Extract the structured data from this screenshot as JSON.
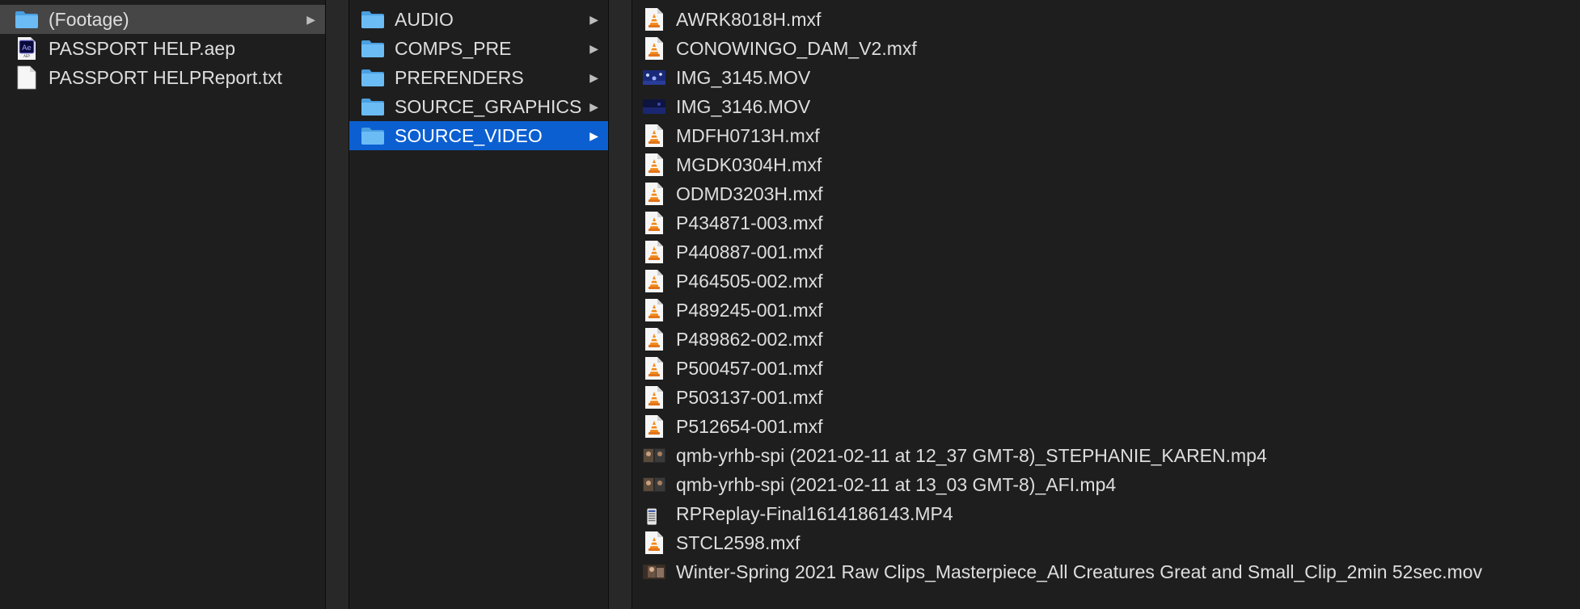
{
  "columns": [
    {
      "items": [
        {
          "label": "(Footage)",
          "icon": "folder-icon",
          "kind": "folder",
          "selected": "inactive",
          "has_children": true
        },
        {
          "label": "PASSPORT HELP.aep",
          "icon": "after-effects-file-icon",
          "kind": "aep",
          "selected": "",
          "has_children": false
        },
        {
          "label": "PASSPORT HELPReport.txt",
          "icon": "text-file-icon",
          "kind": "txt",
          "selected": "",
          "has_children": false
        }
      ]
    },
    {
      "items": [
        {
          "label": "AUDIO",
          "icon": "folder-icon",
          "kind": "folder",
          "selected": "",
          "has_children": true
        },
        {
          "label": "COMPS_PRE",
          "icon": "folder-icon",
          "kind": "folder",
          "selected": "",
          "has_children": true
        },
        {
          "label": "PRERENDERS",
          "icon": "folder-icon",
          "kind": "folder",
          "selected": "",
          "has_children": true
        },
        {
          "label": "SOURCE_GRAPHICS",
          "icon": "folder-icon",
          "kind": "folder",
          "selected": "",
          "has_children": true
        },
        {
          "label": "SOURCE_VIDEO",
          "icon": "folder-icon",
          "kind": "folder",
          "selected": "active",
          "has_children": true
        }
      ]
    },
    {
      "items": [
        {
          "label": "AWRK8018H.mxf",
          "icon": "vlc-file-icon",
          "kind": "mxf",
          "selected": "",
          "has_children": false
        },
        {
          "label": "CONOWINGO_DAM_V2.mxf",
          "icon": "vlc-file-icon",
          "kind": "mxf",
          "selected": "",
          "has_children": false
        },
        {
          "label": "IMG_3145.MOV",
          "icon": "video-thumbnail-icon",
          "kind": "mov-blue",
          "selected": "",
          "has_children": false
        },
        {
          "label": "IMG_3146.MOV",
          "icon": "video-thumbnail-icon",
          "kind": "mov-dark",
          "selected": "",
          "has_children": false
        },
        {
          "label": "MDFH0713H.mxf",
          "icon": "vlc-file-icon",
          "kind": "mxf",
          "selected": "",
          "has_children": false
        },
        {
          "label": "MGDK0304H.mxf",
          "icon": "vlc-file-icon",
          "kind": "mxf",
          "selected": "",
          "has_children": false
        },
        {
          "label": "ODMD3203H.mxf",
          "icon": "vlc-file-icon",
          "kind": "mxf",
          "selected": "",
          "has_children": false
        },
        {
          "label": "P434871-003.mxf",
          "icon": "vlc-file-icon",
          "kind": "mxf",
          "selected": "",
          "has_children": false
        },
        {
          "label": "P440887-001.mxf",
          "icon": "vlc-file-icon",
          "kind": "mxf",
          "selected": "",
          "has_children": false
        },
        {
          "label": "P464505-002.mxf",
          "icon": "vlc-file-icon",
          "kind": "mxf",
          "selected": "",
          "has_children": false
        },
        {
          "label": "P489245-001.mxf",
          "icon": "vlc-file-icon",
          "kind": "mxf",
          "selected": "",
          "has_children": false
        },
        {
          "label": "P489862-002.mxf",
          "icon": "vlc-file-icon",
          "kind": "mxf",
          "selected": "",
          "has_children": false
        },
        {
          "label": "P500457-001.mxf",
          "icon": "vlc-file-icon",
          "kind": "mxf",
          "selected": "",
          "has_children": false
        },
        {
          "label": "P503137-001.mxf",
          "icon": "vlc-file-icon",
          "kind": "mxf",
          "selected": "",
          "has_children": false
        },
        {
          "label": "P512654-001.mxf",
          "icon": "vlc-file-icon",
          "kind": "mxf",
          "selected": "",
          "has_children": false
        },
        {
          "label": "qmb-yrhb-spi (2021-02-11 at 12_37 GMT-8)_STEPHANIE_KAREN.mp4",
          "icon": "video-thumbnail-icon",
          "kind": "mp4-meeting",
          "selected": "",
          "has_children": false
        },
        {
          "label": "qmb-yrhb-spi (2021-02-11 at 13_03 GMT-8)_AFI.mp4",
          "icon": "video-thumbnail-icon",
          "kind": "mp4-meeting",
          "selected": "",
          "has_children": false
        },
        {
          "label": "RPReplay-Final1614186143.MP4",
          "icon": "video-thumbnail-icon",
          "kind": "mp4-phone",
          "selected": "",
          "has_children": false
        },
        {
          "label": "STCL2598.mxf",
          "icon": "vlc-file-icon",
          "kind": "mxf",
          "selected": "",
          "has_children": false
        },
        {
          "label": "Winter-Spring 2021 Raw Clips_Masterpiece_All Creatures Great and Small_Clip_2min 52sec.mov",
          "icon": "video-thumbnail-icon",
          "kind": "mov-scene",
          "selected": "",
          "has_children": false
        }
      ]
    }
  ],
  "colors": {
    "background": "#1e1e1e",
    "selection_active": "#0b5fd1",
    "selection_inactive": "#464646",
    "folder": "#5fb3f0",
    "vlc_orange": "#f28a1c"
  }
}
